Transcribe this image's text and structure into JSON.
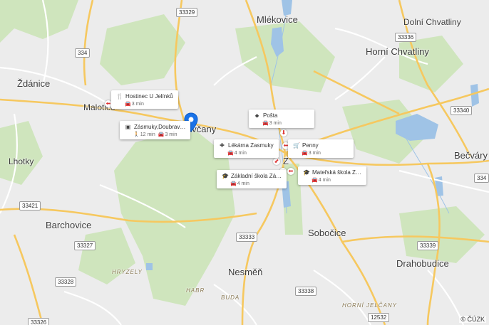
{
  "places": [
    {
      "id": "mlekovice",
      "name": "Mlékovice",
      "big": true
    },
    {
      "id": "dolni-chvatliny",
      "name": "Dolní Chvatliny"
    },
    {
      "id": "horni-chvatliny",
      "name": "Horní Chvatliny",
      "big": true
    },
    {
      "id": "zdanice",
      "name": "Ždánice",
      "big": true
    },
    {
      "id": "malotice",
      "name": "Malotice"
    },
    {
      "id": "doubravcany",
      "name": "avčany",
      "big": true
    },
    {
      "id": "becvary",
      "name": "Bečváry",
      "big": true
    },
    {
      "id": "lhotky",
      "name": "Lhotky"
    },
    {
      "id": "zasmuky",
      "name": "Z",
      "big": true
    },
    {
      "id": "barchovice",
      "name": "Barchovice",
      "big": true
    },
    {
      "id": "sobocice",
      "name": "Sobočice",
      "big": true
    },
    {
      "id": "nesmen",
      "name": "Nesměň",
      "big": true
    },
    {
      "id": "drahobudice",
      "name": "Drahobudice",
      "big": true
    }
  ],
  "areas": [
    {
      "id": "hryzely",
      "name": "HRYZELY"
    },
    {
      "id": "habr",
      "name": "HABR"
    },
    {
      "id": "buda",
      "name": "BUDA"
    },
    {
      "id": "horni-jelcany",
      "name": "HORNÍ JELČANY"
    }
  ],
  "road_numbers": [
    "33329",
    "334",
    "33336",
    "33340",
    "334",
    "33421",
    "33327",
    "33333",
    "33339",
    "33328",
    "33338",
    "12532",
    "33326"
  ],
  "pois": [
    {
      "id": "hostinec",
      "icon": "restaurant-icon",
      "name": "Hostinec U Jelínků",
      "times": [
        {
          "mode": "car-icon",
          "value": "3 min"
        }
      ]
    },
    {
      "id": "bus-stop",
      "icon": "bus-icon",
      "name": "Zásmuky,Doubrav…",
      "times": [
        {
          "mode": "walk-icon",
          "value": "12 min"
        },
        {
          "mode": "car-icon",
          "value": "3 min"
        }
      ]
    },
    {
      "id": "posta",
      "icon": "post-office-icon",
      "name": "Pošta",
      "times": [
        {
          "mode": "car-icon",
          "value": "3 min"
        }
      ]
    },
    {
      "id": "lekarna",
      "icon": "pharmacy-icon",
      "name": "Lékárna Zasmuky",
      "times": [
        {
          "mode": "car-icon",
          "value": "4 min"
        }
      ]
    },
    {
      "id": "penny",
      "icon": "shopping-cart-icon",
      "name": "Penny",
      "times": [
        {
          "mode": "car-icon",
          "value": "3 min"
        }
      ]
    },
    {
      "id": "zakladni-skola",
      "icon": "school-icon",
      "name": "Základní škola Zá…",
      "times": [
        {
          "mode": "car-icon",
          "value": "4 min"
        }
      ]
    },
    {
      "id": "materska-skola",
      "icon": "school-icon",
      "name": "Mateřská škola Z…",
      "times": [
        {
          "mode": "car-icon",
          "value": "4 min"
        }
      ]
    }
  ],
  "icon_glyphs": {
    "restaurant-icon": "🍴",
    "bus-icon": "▣",
    "post-office-icon": "⬥",
    "pharmacy-icon": "✚",
    "shopping-cart-icon": "🛒",
    "school-icon": "🎓",
    "car-icon": "🚘",
    "walk-icon": "🚶"
  },
  "colors": {
    "pin": "#1a73e8",
    "road_major": "#ffd166",
    "water": "#9fc3e6",
    "forest": "#c9e3b7"
  },
  "copyright": "© ČÚZK"
}
